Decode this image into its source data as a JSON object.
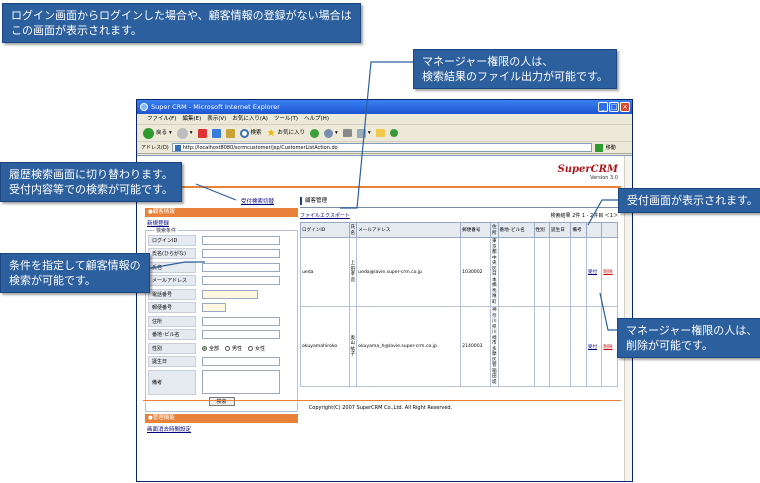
{
  "callouts": {
    "top_left": [
      "ログイン画面からログインした場合や、顧客情報の登録がない場合は",
      "この画面が表示されます。"
    ],
    "manager_export": [
      "マネージャー権限の人は、",
      "検索結果のファイル出力が可能です。"
    ],
    "history_switch": [
      "履歴検索画面に切り替わります。",
      "受付内容等での検索が可能です。"
    ],
    "condition_search": [
      "条件を指定して顧客情報の",
      "検索が可能です。"
    ],
    "reception_screen": [
      "受付画面が表示されます。"
    ],
    "manager_delete": [
      "マネージャー権限の人は、",
      "削除が可能です。"
    ]
  },
  "browser": {
    "title": "Super CRM - Microsoft Internet Explorer",
    "menu": [
      "ファイル(F)",
      "編集(E)",
      "表示(V)",
      "お気に入り(A)",
      "ツール(T)",
      "ヘルプ(H)"
    ],
    "toolbar": {
      "back": "戻る",
      "search": "検索",
      "favorites": "お気に入り"
    },
    "address_label": "アドレス(D)",
    "address_url": "http://localhost8080/scrmcustomer/jsp/CustomerListAction.do",
    "go": "移動"
  },
  "page": {
    "logo": "SuperCRM",
    "version": "Version 3.0",
    "history_switch_link": "受付検索切替",
    "side_header": "●顧客情報",
    "new_register": "新規登録",
    "criteria_legend": "検索条件",
    "fields": [
      {
        "label": "ログインID",
        "kind": "input"
      },
      {
        "label": "氏名(ひらがな)",
        "kind": "input"
      },
      {
        "label": "氏名",
        "kind": "input"
      },
      {
        "label": "メールアドレス",
        "kind": "input"
      },
      {
        "label": "電話番号",
        "kind": "short"
      },
      {
        "label": "郵便番号",
        "kind": "tiny"
      },
      {
        "label": "住所",
        "kind": "input"
      },
      {
        "label": "番地･ビル名",
        "kind": "input"
      },
      {
        "label": "性別",
        "kind": "radio"
      },
      {
        "label": "誕生日",
        "kind": "input"
      },
      {
        "label": "備考",
        "kind": "tall"
      }
    ],
    "gender_options": [
      "全部",
      "男性",
      "女性"
    ],
    "search_button": "検索",
    "manage_header": "●管理機能",
    "manage_link": "画面消去時間設定",
    "main_title": "顧客管理",
    "export_link": "ファイルエクスポート",
    "result_summary": "検索結果 2件 1 - 2件目 ＜1＞",
    "columns": [
      "ログインID",
      "氏名",
      "メールアドレス",
      "郵便番号",
      "住所",
      "番地･ビル名",
      "性別",
      "誕生日",
      "備考",
      "",
      ""
    ],
    "rows": [
      {
        "login_id": "ueda",
        "name": "上田 孝造",
        "email": "ueda@lavie.super-crm.co.jp",
        "zip": "1030002",
        "address": "東京都中央区日本橋馬喰町",
        "reception": "受付",
        "delete": "削除"
      },
      {
        "login_id": "okuyamahiroko",
        "name": "奥山 紘子",
        "email": "okuyama_h@lavie.super-crm.co.jp",
        "zip": "2140003",
        "address": "神奈川県川崎市多摩区菅稲田堤",
        "reception": "受付",
        "delete": "削除"
      }
    ],
    "copyright": "Copyright(C) 2007 SuperCRM Co.,Ltd. All Right Reserved."
  }
}
